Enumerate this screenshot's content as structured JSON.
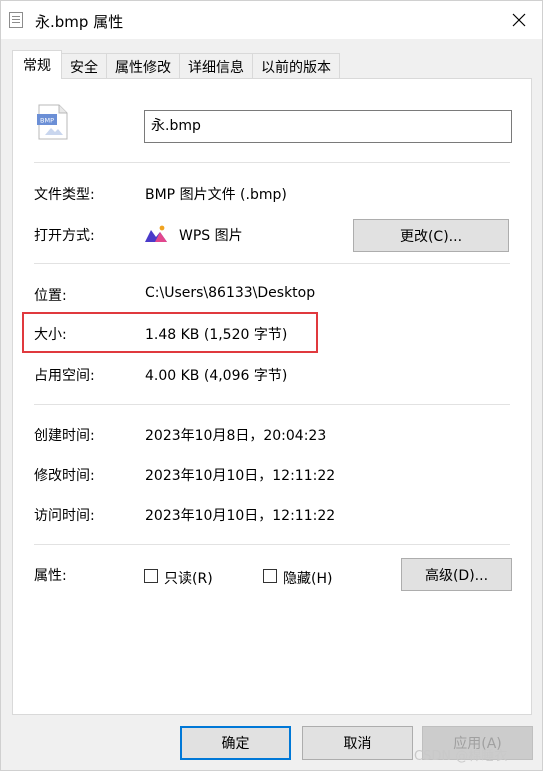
{
  "window": {
    "title": "永.bmp 属性"
  },
  "tabs": [
    {
      "label": "常规"
    },
    {
      "label": "安全"
    },
    {
      "label": "属性修改"
    },
    {
      "label": "详细信息"
    },
    {
      "label": "以前的版本"
    }
  ],
  "file": {
    "icon_label": "BMP",
    "name": "永.bmp"
  },
  "fields": {
    "type_label": "文件类型:",
    "type_value": "BMP 图片文件 (.bmp)",
    "open_label": "打开方式:",
    "open_value": "WPS 图片",
    "change_button": "更改(C)...",
    "location_label": "位置:",
    "location_value": "C:\\Users\\86133\\Desktop",
    "size_label": "大小:",
    "size_value": "1.48 KB (1,520 字节)",
    "disk_label": "占用空间:",
    "disk_value": "4.00 KB (4,096 字节)",
    "created_label": "创建时间:",
    "created_value": "2023年10月8日，20:04:23",
    "modified_label": "修改时间:",
    "modified_value": "2023年10月10日，12:11:22",
    "accessed_label": "访问时间:",
    "accessed_value": "2023年10月10日，12:11:22",
    "attr_label": "属性:",
    "readonly_label": "只读(R)",
    "hidden_label": "隐藏(H)",
    "advanced_button": "高级(D)..."
  },
  "footer": {
    "ok_button": "确定",
    "cancel_button": "取消",
    "apply_button": "应用(A)"
  },
  "watermark": "CSDN @棉睡衣",
  "colors": {
    "highlight": "#e0393e",
    "primary_border": "#0078d7"
  }
}
